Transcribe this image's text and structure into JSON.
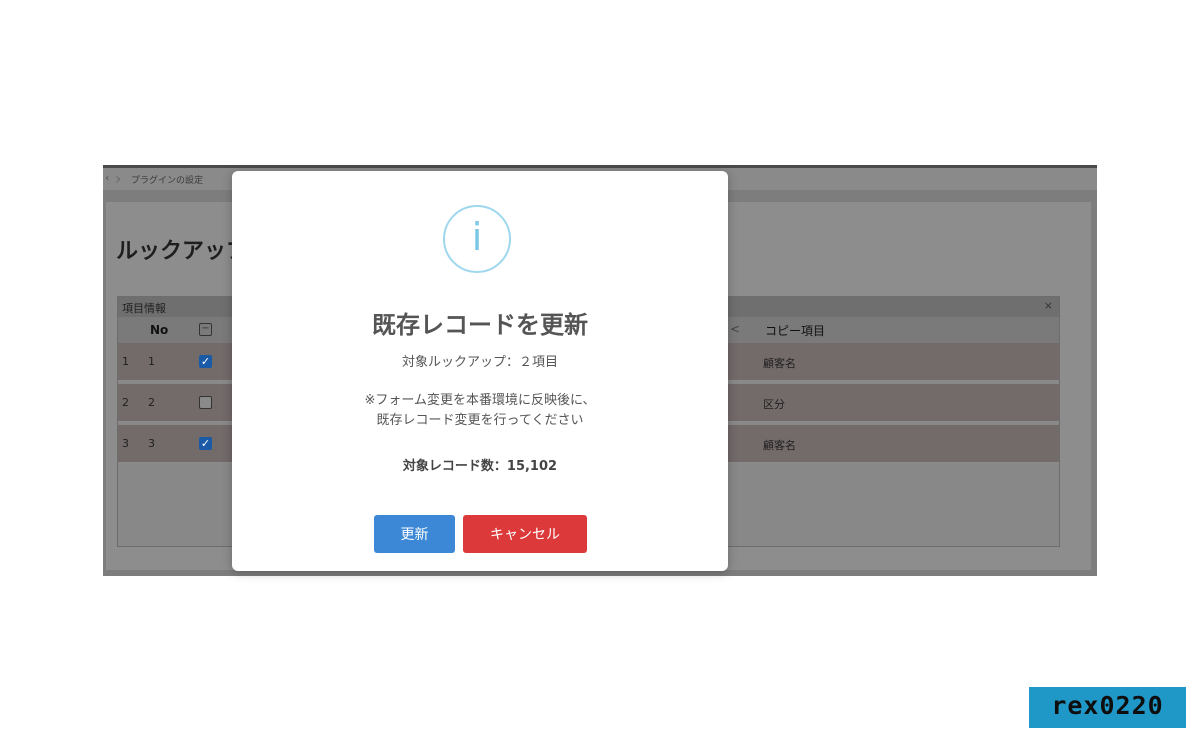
{
  "background": {
    "breadcrumb": "プラグインの設定",
    "page_title": "ルックアップ",
    "table": {
      "header_label": "項目情報",
      "collapse_icon": "×",
      "columns": [
        "No",
        "コピー項目"
      ],
      "partial_column_mark": "<",
      "rows": [
        {
          "index": "1",
          "no": "1",
          "checked": true,
          "copy_field": "顧客名"
        },
        {
          "index": "2",
          "no": "2",
          "checked": false,
          "copy_field": "区分"
        },
        {
          "index": "3",
          "no": "3",
          "checked": true,
          "copy_field": "顧客名"
        }
      ]
    }
  },
  "dialog": {
    "icon": "info-icon",
    "icon_glyph": "i",
    "title": "既存レコードを更新",
    "target_lookup": "対象ルックアップ：２項目",
    "note_line1": "※フォーム変更を本番環境に反映後に、",
    "note_line2": "既存レコード変更を行ってください",
    "record_count": "対象レコード数：15,102",
    "update_button": "更新",
    "cancel_button": "キャンセル"
  },
  "watermark": "rex0220",
  "colors": {
    "update": "#3d88d6",
    "cancel": "#dc3a3a",
    "info": "#9fd7ee",
    "watermark_bg": "#1f98c7"
  }
}
